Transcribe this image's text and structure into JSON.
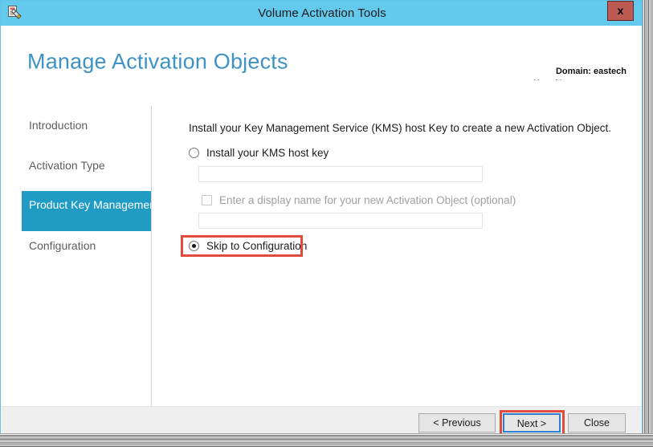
{
  "window": {
    "title": "Volume Activation Tools",
    "close_label": "x",
    "app_icon": "volume-activation-tools-icon"
  },
  "header": {
    "page_title": "Manage Activation Objects",
    "domain_line": "Domain: eastech",
    "user_line": "User Name: azureuser"
  },
  "sidebar": {
    "items": [
      {
        "label": "Introduction",
        "active": false
      },
      {
        "label": "Activation Type",
        "active": false
      },
      {
        "label": "Product Key Management",
        "active": true
      },
      {
        "label": "Configuration",
        "active": false
      }
    ]
  },
  "main": {
    "instruction": "Install your Key Management Service (KMS) host Key to create a new Activation Object.",
    "option_install_kms": "Install your KMS host key",
    "kms_key_value": "",
    "kms_key_placeholder": "",
    "checkbox_display_name": "Enter a display name for your new Activation Object (optional)",
    "display_name_value": "",
    "display_name_placeholder": "",
    "option_skip": "Skip to Configuration",
    "selected_option": "skip"
  },
  "footer": {
    "previous_label": "< Previous",
    "next_label": "Next >",
    "close_label": "Close"
  },
  "colors": {
    "titlebar": "#63c9ed",
    "accent": "#1f9bc4",
    "heading": "#3e93c4",
    "annotation": "#e04b3c",
    "close_button": "#bd5a53",
    "focus_border": "#2f7fd0",
    "footer_bg": "#efeff0"
  }
}
